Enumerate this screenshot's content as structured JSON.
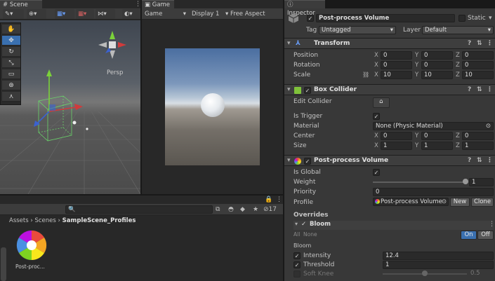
{
  "scene": {
    "tab": "Scene",
    "persp": "Persp"
  },
  "game": {
    "tab": "Game",
    "mode": "Game",
    "display": "Display 1",
    "aspect": "Free Aspect"
  },
  "project": {
    "breadcrumb": [
      "Assets",
      "Scenes",
      "SampleScene_Profiles"
    ],
    "hidden_count": "17",
    "asset_label": "Post-proc..."
  },
  "inspector": {
    "tab": "Inspector",
    "object_name": "Post-process Volume",
    "static_label": "Static",
    "tag_label": "Tag",
    "tag_value": "Untagged",
    "layer_label": "Layer",
    "layer_value": "Default",
    "transform": {
      "title": "Transform",
      "rows": [
        {
          "label": "Position",
          "x": "0",
          "y": "0",
          "z": "0"
        },
        {
          "label": "Rotation",
          "x": "0",
          "y": "0",
          "z": "0"
        },
        {
          "label": "Scale",
          "x": "10",
          "y": "10",
          "z": "10"
        }
      ]
    },
    "box_collider": {
      "title": "Box Collider",
      "edit_collider": "Edit Collider",
      "is_trigger": "Is Trigger",
      "material_label": "Material",
      "material_value": "None (Physic Material)",
      "center_label": "Center",
      "center": {
        "x": "0",
        "y": "0",
        "z": "0"
      },
      "size_label": "Size",
      "size": {
        "x": "1",
        "y": "1",
        "z": "1"
      }
    },
    "volume": {
      "title": "Post-process Volume",
      "is_global": "Is Global",
      "weight_label": "Weight",
      "weight_value": "1",
      "weight_fraction": 1.0,
      "priority_label": "Priority",
      "priority_value": "0",
      "profile_label": "Profile",
      "profile_value": "Post-process Volume",
      "new_label": "New",
      "clone_label": "Clone"
    },
    "overrides": {
      "title": "Overrides",
      "bloom_title": "Bloom",
      "all_label": "All",
      "none_label": "None",
      "on_label": "On",
      "off_label": "Off",
      "group_label": "Bloom",
      "intensity_label": "Intensity",
      "intensity_value": "12.4",
      "threshold_label": "Threshold",
      "threshold_value": "1",
      "softknee_label": "Soft Knee",
      "softknee_value": "0.5",
      "softknee_fraction": 0.5
    },
    "axes": {
      "x": "X",
      "y": "Y",
      "z": "Z"
    }
  },
  "colors": {
    "accent": "#3a70b0",
    "panel": "#383838",
    "dark": "#191919"
  }
}
